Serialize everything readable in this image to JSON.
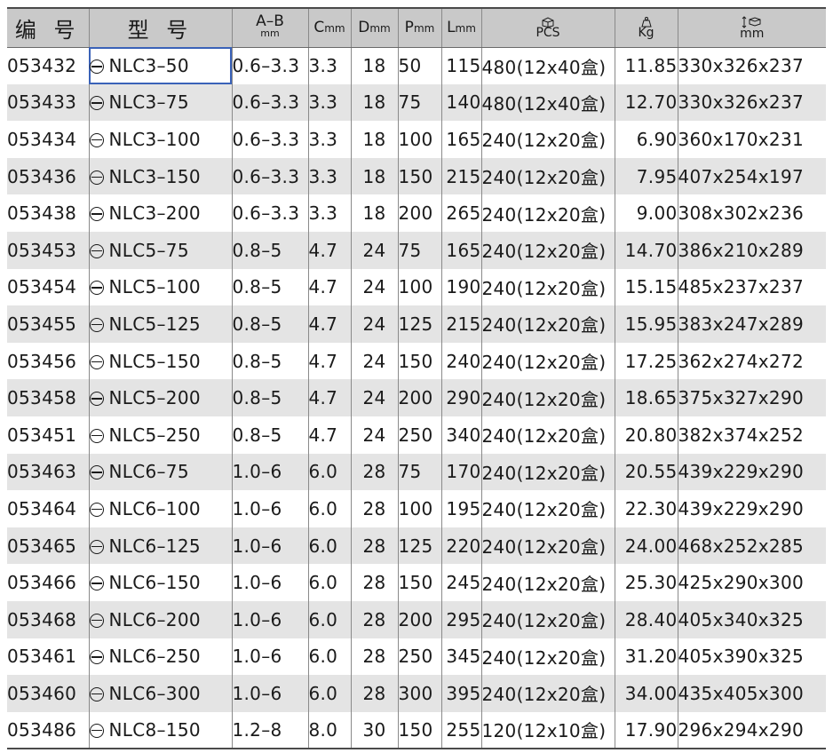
{
  "headers": {
    "code": "编 号",
    "model": "型 号",
    "ab": "A–B",
    "ab_unit": "mm",
    "c": "C",
    "d": "D",
    "p": "P",
    "l": "L",
    "dim_unit": "mm",
    "pcs": "PCS",
    "kg": "Kg",
    "size_unit": "mm"
  },
  "icons": {
    "pcs": "box-icon",
    "kg": "weight-icon",
    "size": "dimension-icon",
    "model": "minus-circle-icon"
  },
  "rows": [
    {
      "code": "053432",
      "model": "NLC3–50",
      "ab": "0.6–3.3",
      "c": "3.3",
      "d": "18",
      "p": "50",
      "l": "115",
      "pcs": "480(12x40盒)",
      "kg": "11.85",
      "size": "330x326x237"
    },
    {
      "code": "053433",
      "model": "NLC3–75",
      "ab": "0.6–3.3",
      "c": "3.3",
      "d": "18",
      "p": "75",
      "l": "140",
      "pcs": "480(12x40盒)",
      "kg": "12.70",
      "size": "330x326x237"
    },
    {
      "code": "053434",
      "model": "NLC3–100",
      "ab": "0.6–3.3",
      "c": "3.3",
      "d": "18",
      "p": "100",
      "l": "165",
      "pcs": "240(12x20盒)",
      "kg": "6.90",
      "size": "360x170x231"
    },
    {
      "code": "053436",
      "model": "NLC3–150",
      "ab": "0.6–3.3",
      "c": "3.3",
      "d": "18",
      "p": "150",
      "l": "215",
      "pcs": "240(12x20盒)",
      "kg": "7.95",
      "size": "407x254x197"
    },
    {
      "code": "053438",
      "model": "NLC3–200",
      "ab": "0.6–3.3",
      "c": "3.3",
      "d": "18",
      "p": "200",
      "l": "265",
      "pcs": "240(12x20盒)",
      "kg": "9.00",
      "size": "308x302x236"
    },
    {
      "code": "053453",
      "model": "NLC5–75",
      "ab": "0.8–5",
      "c": "4.7",
      "d": "24",
      "p": "75",
      "l": "165",
      "pcs": "240(12x20盒)",
      "kg": "14.70",
      "size": "386x210x289"
    },
    {
      "code": "053454",
      "model": "NLC5–100",
      "ab": "0.8–5",
      "c": "4.7",
      "d": "24",
      "p": "100",
      "l": "190",
      "pcs": "240(12x20盒)",
      "kg": "15.15",
      "size": "485x237x237"
    },
    {
      "code": "053455",
      "model": "NLC5–125",
      "ab": "0.8–5",
      "c": "4.7",
      "d": "24",
      "p": "125",
      "l": "215",
      "pcs": "240(12x20盒)",
      "kg": "15.95",
      "size": "383x247x289"
    },
    {
      "code": "053456",
      "model": "NLC5–150",
      "ab": "0.8–5",
      "c": "4.7",
      "d": "24",
      "p": "150",
      "l": "240",
      "pcs": "240(12x20盒)",
      "kg": "17.25",
      "size": "362x274x272"
    },
    {
      "code": "053458",
      "model": "NLC5–200",
      "ab": "0.8–5",
      "c": "4.7",
      "d": "24",
      "p": "200",
      "l": "290",
      "pcs": "240(12x20盒)",
      "kg": "18.65",
      "size": "375x327x290"
    },
    {
      "code": "053451",
      "model": "NLC5–250",
      "ab": "0.8–5",
      "c": "4.7",
      "d": "24",
      "p": "250",
      "l": "340",
      "pcs": "240(12x20盒)",
      "kg": "20.80",
      "size": "382x374x252"
    },
    {
      "code": "053463",
      "model": "NLC6–75",
      "ab": "1.0–6",
      "c": "6.0",
      "d": "28",
      "p": "75",
      "l": "170",
      "pcs": "240(12x20盒)",
      "kg": "20.55",
      "size": "439x229x290"
    },
    {
      "code": "053464",
      "model": "NLC6–100",
      "ab": "1.0–6",
      "c": "6.0",
      "d": "28",
      "p": "100",
      "l": "195",
      "pcs": "240(12x20盒)",
      "kg": "22.30",
      "size": "439x229x290"
    },
    {
      "code": "053465",
      "model": "NLC6–125",
      "ab": "1.0–6",
      "c": "6.0",
      "d": "28",
      "p": "125",
      "l": "220",
      "pcs": "240(12x20盒)",
      "kg": "24.00",
      "size": "468x252x285"
    },
    {
      "code": "053466",
      "model": "NLC6–150",
      "ab": "1.0–6",
      "c": "6.0",
      "d": "28",
      "p": "150",
      "l": "245",
      "pcs": "240(12x20盒)",
      "kg": "25.30",
      "size": "425x290x300"
    },
    {
      "code": "053468",
      "model": "NLC6–200",
      "ab": "1.0–6",
      "c": "6.0",
      "d": "28",
      "p": "200",
      "l": "295",
      "pcs": "240(12x20盒)",
      "kg": "28.40",
      "size": "405x340x325"
    },
    {
      "code": "053461",
      "model": "NLC6–250",
      "ab": "1.0–6",
      "c": "6.0",
      "d": "28",
      "p": "250",
      "l": "345",
      "pcs": "240(12x20盒)",
      "kg": "31.20",
      "size": "405x390x325"
    },
    {
      "code": "053460",
      "model": "NLC6–300",
      "ab": "1.0–6",
      "c": "6.0",
      "d": "28",
      "p": "300",
      "l": "395",
      "pcs": "240(12x20盒)",
      "kg": "34.00",
      "size": "435x405x300"
    },
    {
      "code": "053486",
      "model": "NLC8–150",
      "ab": "1.2–8",
      "c": "8.0",
      "d": "30",
      "p": "150",
      "l": "255",
      "pcs": "120(12x10盒)",
      "kg": "17.90",
      "size": "296x294x290"
    }
  ],
  "selected_cell": {
    "row": 0,
    "column": "model"
  },
  "colors": {
    "header_bg": "#c9c9c9",
    "stripe_bg": "#e4e4e4",
    "selection": "#3a62b8"
  }
}
